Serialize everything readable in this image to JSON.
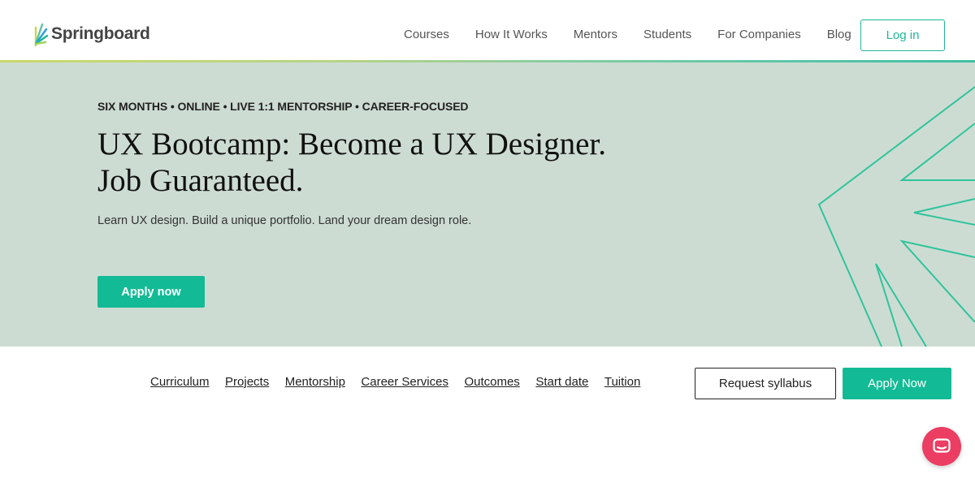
{
  "brand": {
    "name": "Springboard"
  },
  "nav": {
    "items": [
      {
        "label": "Courses"
      },
      {
        "label": "How It Works"
      },
      {
        "label": "Mentors"
      },
      {
        "label": "Students"
      },
      {
        "label": "For Companies"
      },
      {
        "label": "Blog"
      }
    ],
    "login_label": "Log in"
  },
  "hero": {
    "eyebrow": "SIX MONTHS • ONLINE • LIVE 1:1 MENTORSHIP • CAREER-FOCUSED",
    "title_line1": "UX Bootcamp: Become a UX Designer.",
    "title_line2": "Job Guaranteed.",
    "subtitle": "Learn UX design. Build a unique portfolio. Land your dream design role.",
    "cta_label": "Apply now"
  },
  "subnav": {
    "links": [
      {
        "label": "Curriculum"
      },
      {
        "label": "Projects"
      },
      {
        "label": "Mentorship"
      },
      {
        "label": "Career Services"
      },
      {
        "label": "Outcomes"
      },
      {
        "label": "Start date"
      },
      {
        "label": "Tuition"
      }
    ],
    "syllabus_label": "Request syllabus",
    "apply_label": "Apply Now"
  },
  "chat": {
    "icon": "chat-icon"
  },
  "colors": {
    "accent": "#12bb95",
    "hero_bg": "#cddcd3",
    "chat": "#ec3d62"
  }
}
